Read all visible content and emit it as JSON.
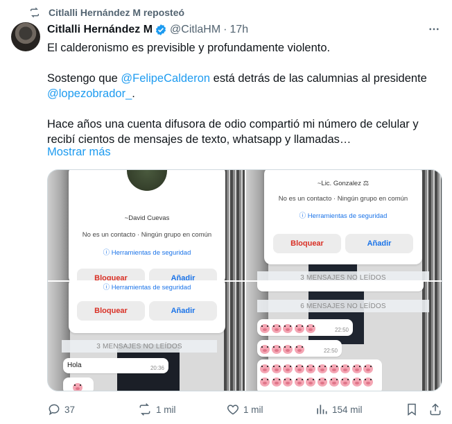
{
  "repost": {
    "label": "Citlalli Hernández M reposteó",
    "icon": "repost-icon"
  },
  "tweet": {
    "author_name": "Citlalli Hernández M",
    "handle": "@CitlaHM",
    "separator": "·",
    "time": "17h",
    "more_icon": "more-icon",
    "verified_icon": "verified-badge-icon",
    "text": {
      "p1": "El calderonismo es previsible y profundamente violento.",
      "p2_a": "Sostengo que ",
      "p2_mention1": "@FelipeCalderon",
      "p2_b": " está detrás de las calumnias al presidente ",
      "p2_mention2": "@lopezobrador_",
      "p2_c": ".",
      "p3": "Hace años una cuenta difusora de odio compartió mi número de celular y recibí cientos de mensajes de texto, whatsapp y llamadas…"
    },
    "show_more": "Mostrar más"
  },
  "media": {
    "tile1": {
      "contact_name": "~David Cuevas",
      "info": "No es un contacto · Ningún grupo en común",
      "security": "Herramientas de seguridad",
      "block": "Bloquear",
      "add": "Añadir"
    },
    "tile2": {
      "contact_name": "~Lic. Gonzalez",
      "info": "No es un contacto · Ningún grupo en común",
      "security": "Herramientas de seguridad",
      "block": "Bloquear",
      "add": "Añadir",
      "unread": "3 MENSAJES NO LEÍDOS"
    },
    "tile3": {
      "security": "Herramientas de seguridad",
      "block": "Bloquear",
      "add": "Añadir",
      "unread": "3 MENSAJES NO LEÍDOS",
      "message": "Hola",
      "message_time": "20:36"
    },
    "tile4": {
      "unread": "6 MENSAJES NO LEÍDOS",
      "time1": "22:50",
      "time2": "22:50",
      "pig_counts": [
        5,
        4,
        10,
        10
      ]
    }
  },
  "actions": {
    "replies": "37",
    "reposts": "1 mil",
    "likes": "1 mil",
    "views": "154 mil",
    "reply_icon": "reply-icon",
    "repost_icon": "repost-icon",
    "like_icon": "heart-icon",
    "views_icon": "views-chart-icon",
    "bookmark_icon": "bookmark-icon",
    "share_icon": "share-icon"
  },
  "colors": {
    "accent": "#1d9bf0",
    "text": "#0f1419",
    "muted": "#536471",
    "verified": "#1d9bf0"
  }
}
